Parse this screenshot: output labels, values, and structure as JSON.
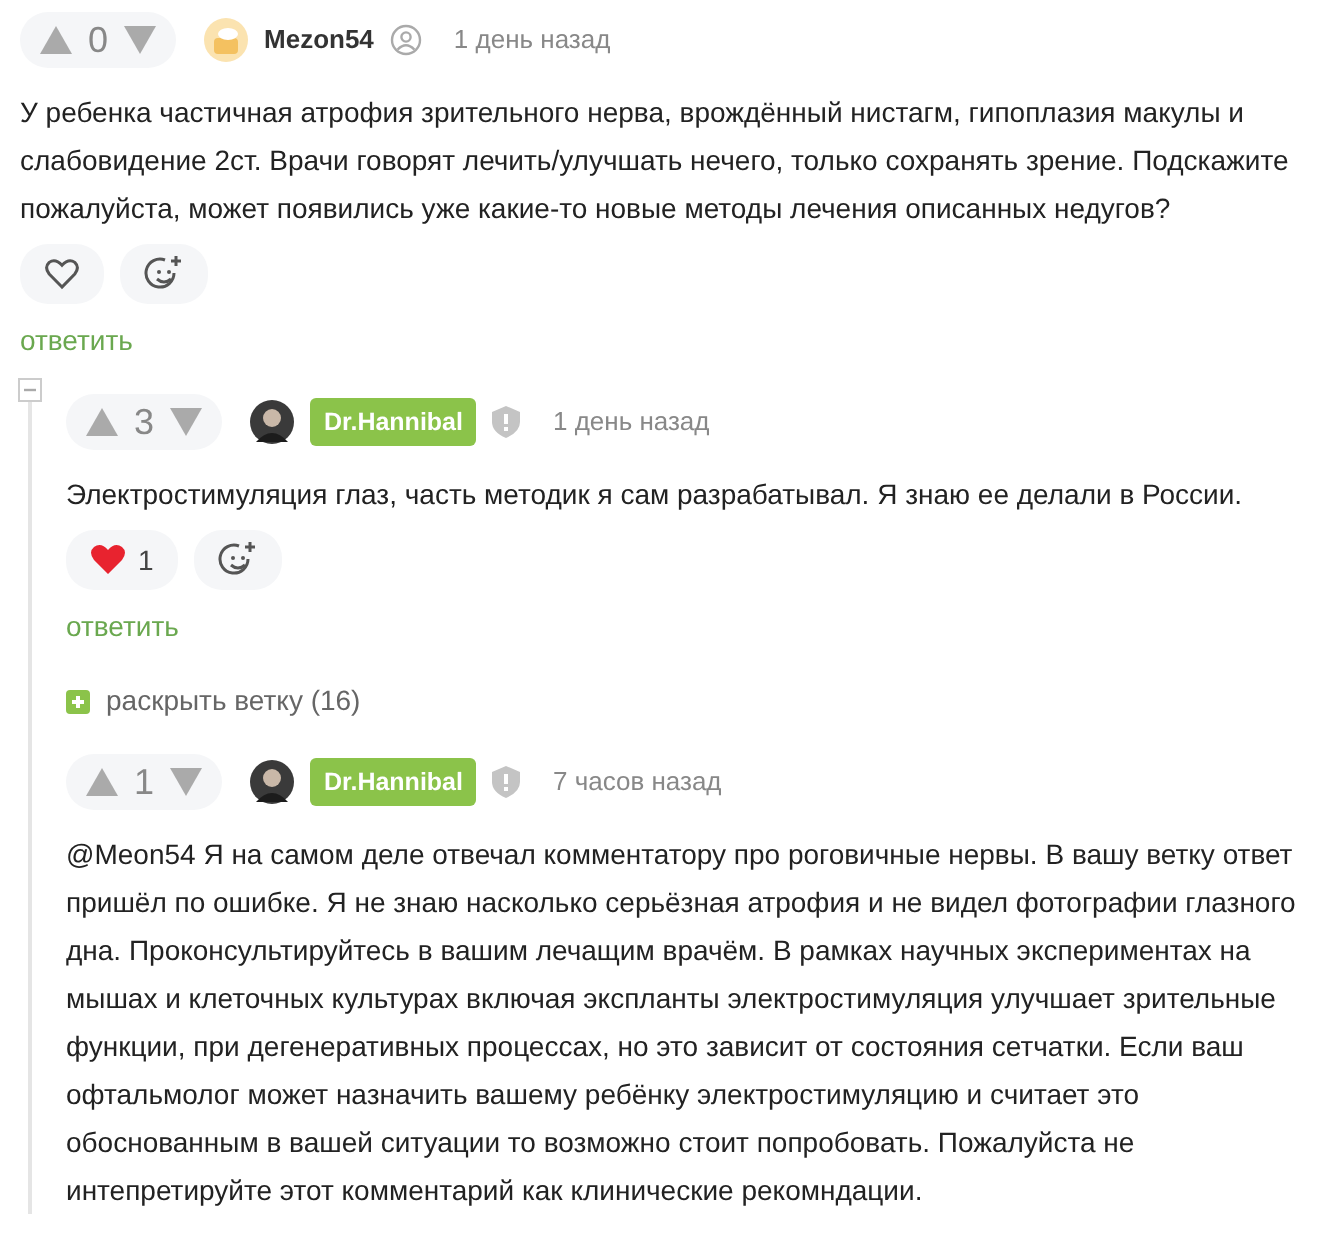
{
  "comments": [
    {
      "score": "0",
      "author": "Mezon54",
      "author_highlighted": false,
      "author_icon": {
        "kind": "user"
      },
      "avatar": {
        "kind": "cat"
      },
      "time": "1 день назад",
      "text": "У ребенка частичная атрофия зрительного нерва, врождённый нистагм, гипоплазия макулы и слабовидение 2ст. Врачи говорят лечить/улучшать нечего, только сохранять зрение. Подскажите пожалуйста, может появились уже какие-то новые методы лечения описанных недугов?",
      "liked": false,
      "reply": "ответить",
      "expanded": true,
      "children": [
        {
          "score": "3",
          "author": "Dr.Hannibal",
          "author_highlighted": true,
          "author_icon": {
            "kind": "shield"
          },
          "avatar": {
            "kind": "person"
          },
          "time": "1 день назад",
          "text": "Электростимуляция глаз, часть методик я сам разрабатывал. Я знаю ее делали в России.",
          "liked": true,
          "likes": "1",
          "reply": "ответить",
          "expand_thread": "раскрыть ветку (16)"
        },
        {
          "score": "1",
          "author": "Dr.Hannibal",
          "author_highlighted": true,
          "author_icon": {
            "kind": "shield"
          },
          "avatar": {
            "kind": "person"
          },
          "time": "7 часов назад",
          "text": "@Meon54 Я на самом деле отвечал комментатору про роговичные нервы. В вашу ветку ответ пришёл по ошибке. Я не знаю насколько серьёзная атрофия и не видел фотографии глазного дна. Проконсультируйтесь в вашим лечащим врачём. В рамках научных экспериментах на мышах и клеточных культурах включая экспланты электростимуляция улучшает зрительные функции, при дегенеративных процессах, но это зависит от состояния сетчатки. Если ваш офтальмолог может назначить вашему ребёнку электростимуляцию и считает это обоснованным в вашей ситуации то возможно стоит попробовать. Пожалуйста не интепретируйте этот комментарий как клинические рекомндации."
        }
      ]
    }
  ]
}
